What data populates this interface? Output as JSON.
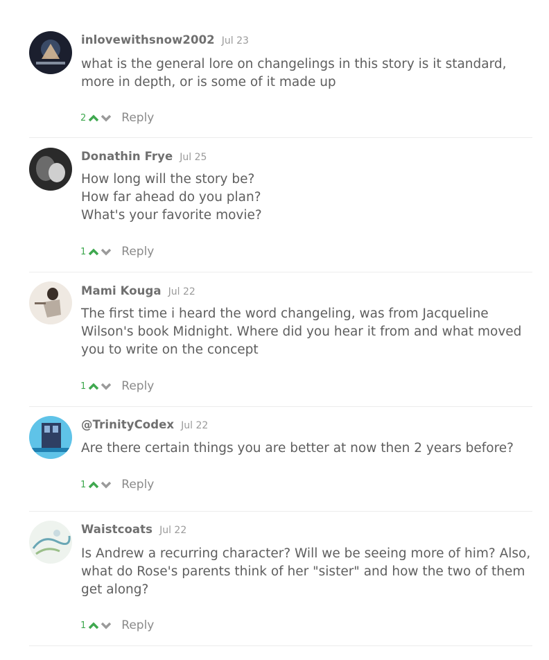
{
  "comments": [
    {
      "author": "inlovewithsnow2002",
      "date": "Jul 23",
      "lines": [
        "what is the general lore on changelings in this story is it standard,",
        "more in depth, or is some of it made up"
      ],
      "votes": "2",
      "reply_label": "Reply"
    },
    {
      "author": "Donathin Frye",
      "date": "Jul 25",
      "lines": [
        "How long will the story be?",
        "How far ahead do you plan?",
        "What's your favorite movie?"
      ],
      "votes": "1",
      "reply_label": "Reply"
    },
    {
      "author": "Mami Kouga",
      "date": "Jul 22",
      "lines": [
        "The first time i heard the word changeling, was from Jacqueline",
        "Wilson's book Midnight. Where did you hear it from and what moved",
        "you to write on the concept"
      ],
      "votes": "1",
      "reply_label": "Reply"
    },
    {
      "author": "@TrinityCodex",
      "date": "Jul 22",
      "lines": [
        "Are there certain things you are better at now then 2 years before?"
      ],
      "votes": "1",
      "reply_label": "Reply"
    },
    {
      "author": "Waistcoats",
      "date": "Jul 22",
      "lines": [
        "Is Andrew a recurring character? Will we be seeing more of him? Also,",
        "what do Rose's parents think of her \"sister\" and how the two of them",
        "get along?"
      ],
      "votes": "1",
      "reply_label": "Reply"
    }
  ],
  "colors": {
    "upvote": "#3fa84f",
    "downvote": "#9a9a9a"
  },
  "icons": {
    "up": "chevron-up-icon",
    "down": "chevron-down-icon"
  }
}
